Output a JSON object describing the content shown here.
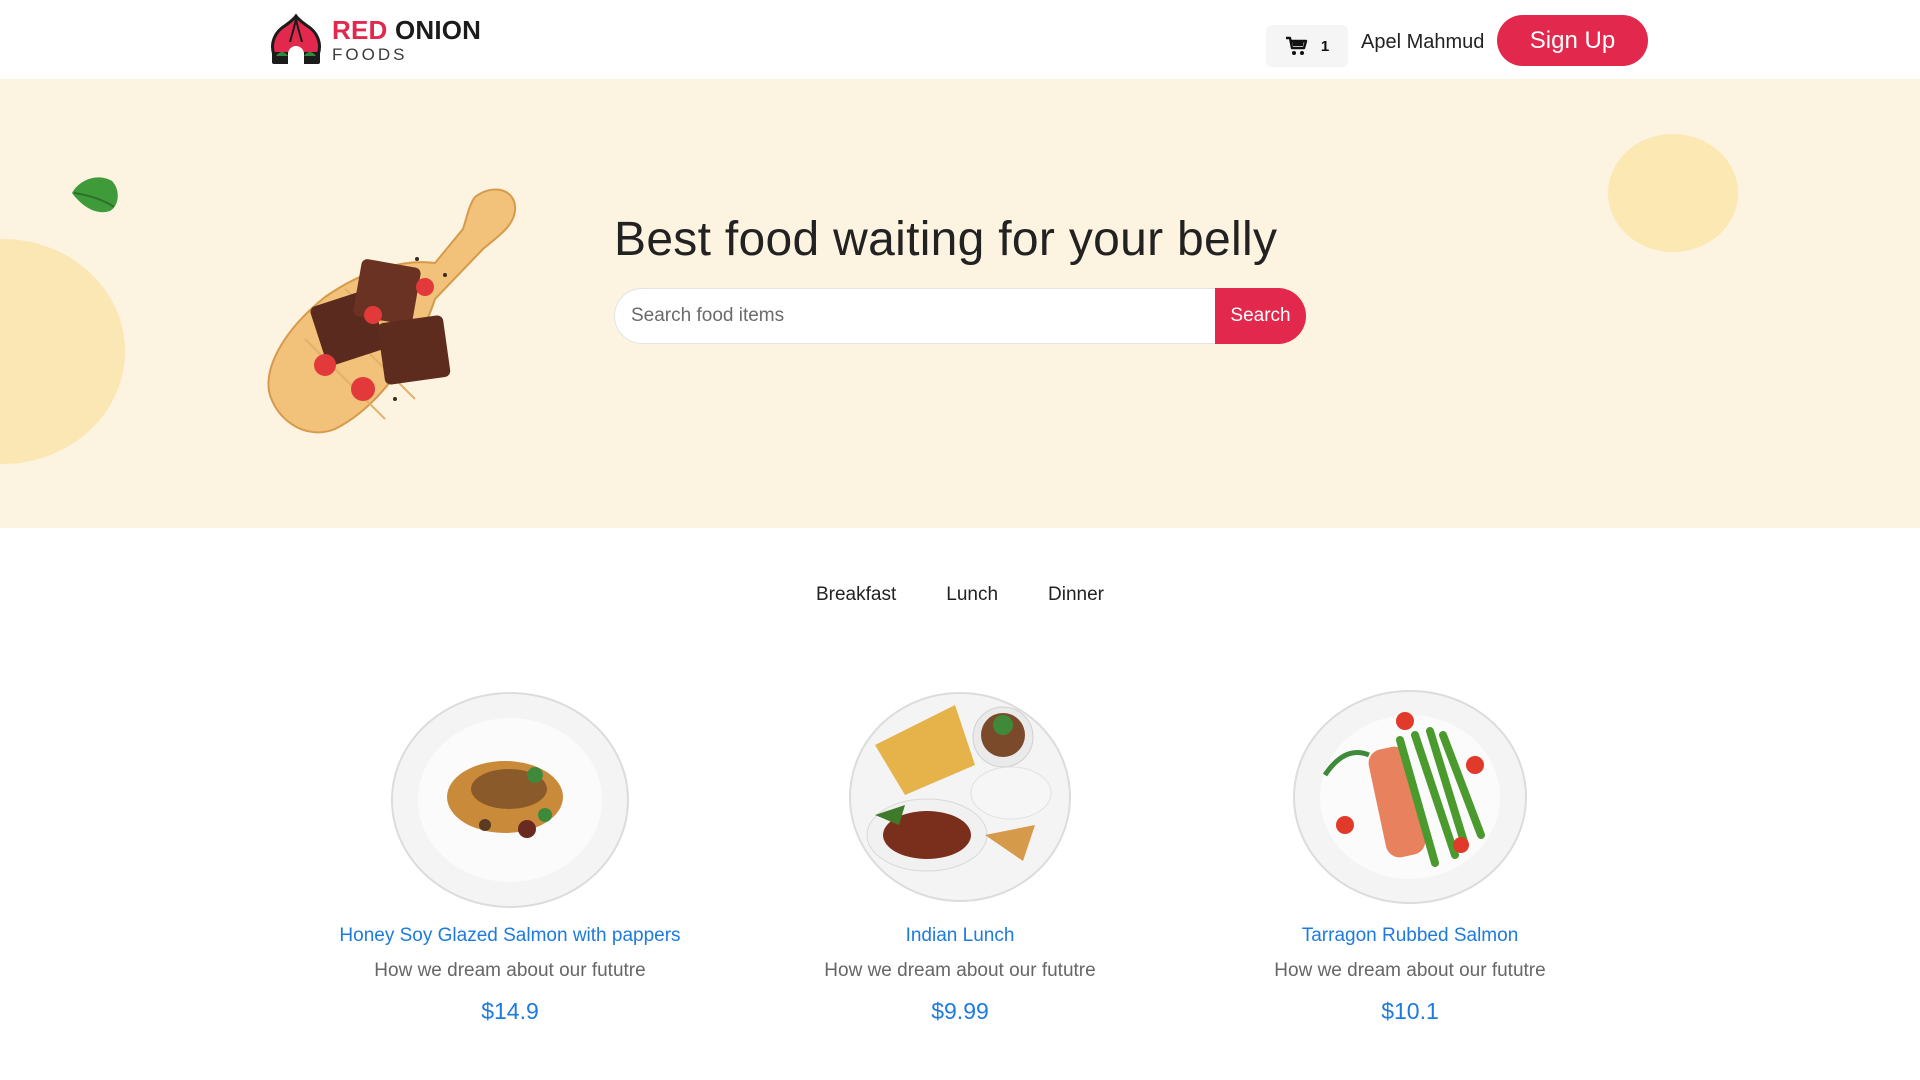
{
  "brand": {
    "name_red": "RED",
    "name_black": "ONION",
    "sub": "FOODS"
  },
  "header": {
    "cart_count": "1",
    "user_name": "Apel Mahmud",
    "signup_label": "Sign Up"
  },
  "hero": {
    "title": "Best food waiting for your belly",
    "search_placeholder": "Search food items",
    "search_label": "Search"
  },
  "tabs": [
    {
      "label": "Breakfast"
    },
    {
      "label": "Lunch"
    },
    {
      "label": "Dinner"
    }
  ],
  "foods": [
    {
      "title": "Honey Soy Glazed Salmon with pappers",
      "desc": "How we dream about our fututre",
      "price": "$14.9"
    },
    {
      "title": "Indian Lunch",
      "desc": "How we dream about our fututre",
      "price": "$9.99"
    },
    {
      "title": "Tarragon Rubbed Salmon",
      "desc": "How we dream about our fututre",
      "price": "$10.1"
    }
  ],
  "colors": {
    "accent": "#e2284d",
    "link": "#1d7be0",
    "hero_bg": "#fdf3e1"
  }
}
